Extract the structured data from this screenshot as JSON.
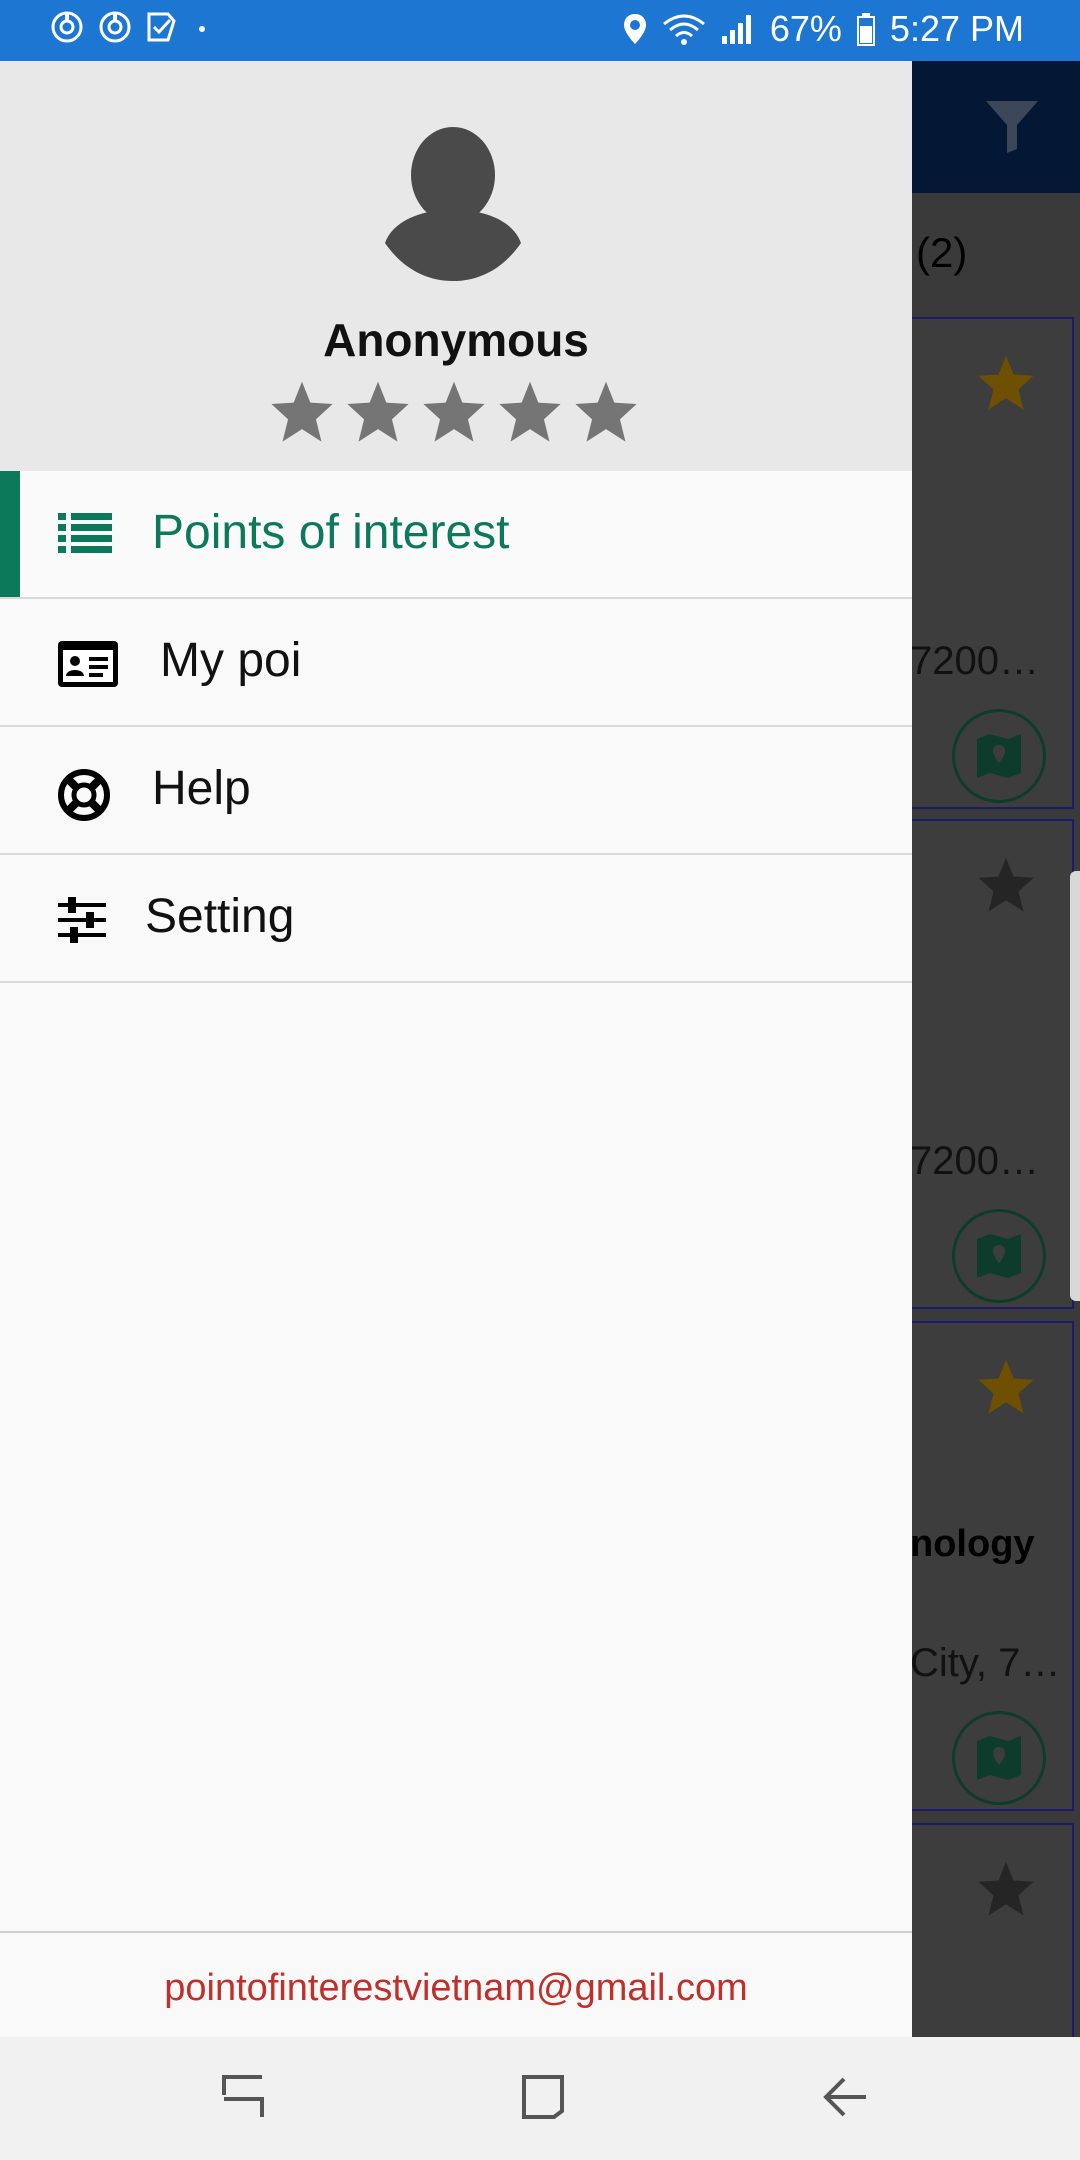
{
  "status_bar": {
    "battery": "67%",
    "time": "5:27 PM"
  },
  "background": {
    "count_label": "(2)",
    "card1_address": "7200…",
    "card2_address": "7200…",
    "card3_title": "nology",
    "card3_address": "City, 7…"
  },
  "drawer": {
    "user_name": "Anonymous",
    "rating_stars": 5,
    "menu": [
      {
        "label": "Points of interest",
        "icon": "list-icon",
        "active": true
      },
      {
        "label": "My poi",
        "icon": "id-card-icon",
        "active": false
      },
      {
        "label": "Help",
        "icon": "lifebuoy-icon",
        "active": false
      },
      {
        "label": "Setting",
        "icon": "sliders-icon",
        "active": false
      }
    ],
    "footer_email": "pointofinterestvietnam@gmail.com"
  },
  "colors": {
    "status_bar": "#1c76d2",
    "accent": "#0c7a5a",
    "email": "#c0302a",
    "toolbar": "#041835"
  }
}
